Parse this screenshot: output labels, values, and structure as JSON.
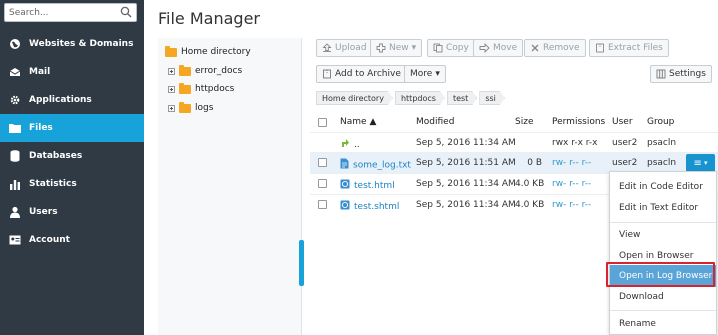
{
  "sidebar": {
    "search": {
      "placeholder": "Search...",
      "value": ""
    },
    "items": [
      {
        "label": "Websites & Domains",
        "icon": "globe-icon",
        "active": false
      },
      {
        "label": "Mail",
        "icon": "envelope-icon",
        "active": false
      },
      {
        "label": "Applications",
        "icon": "gear-icon",
        "active": false
      },
      {
        "label": "Files",
        "icon": "folder-icon",
        "active": true
      },
      {
        "label": "Databases",
        "icon": "database-icon",
        "active": false
      },
      {
        "label": "Statistics",
        "icon": "bar-chart-icon",
        "active": false
      },
      {
        "label": "Users",
        "icon": "user-icon",
        "active": false
      },
      {
        "label": "Account",
        "icon": "id-card-icon",
        "active": false
      }
    ]
  },
  "page": {
    "title": "File Manager"
  },
  "tree": {
    "root": "Home directory",
    "children": [
      "error_docs",
      "httpdocs",
      "logs"
    ]
  },
  "toolbar": {
    "upload": "Upload",
    "new": "New",
    "copy": "Copy",
    "move": "Move",
    "remove": "Remove",
    "extract": "Extract Files",
    "archive": "Add to Archive",
    "more": "More",
    "settings": "Settings"
  },
  "breadcrumb": [
    "Home directory",
    "httpdocs",
    "test",
    "ssi"
  ],
  "table": {
    "headers": {
      "name": "Name",
      "modified": "Modified",
      "size": "Size",
      "permissions": "Permissions",
      "user": "User",
      "group": "Group"
    },
    "rows": [
      {
        "name": "..",
        "modified": "Sep 5, 2016 11:34 AM",
        "size": "",
        "permissions": "rwx r-x r-x",
        "user": "user2",
        "group": "psacln"
      },
      {
        "name": "some_log.txt",
        "modified": "Sep 5, 2016 11:51 AM",
        "size": "0 B",
        "permissions": "rw- r-- r--",
        "user": "user2",
        "group": "psacln"
      },
      {
        "name": "test.html",
        "modified": "Sep 5, 2016 11:34 AM",
        "size": "4.0 KB",
        "permissions": "rw- r-- r--",
        "user": "",
        "group": ""
      },
      {
        "name": "test.shtml",
        "modified": "Sep 5, 2016 11:34 AM",
        "size": "4.0 KB",
        "permissions": "rw- r-- r--",
        "user": "",
        "group": ""
      }
    ]
  },
  "context_menu": {
    "items": [
      "Edit in Code Editor",
      "Edit in Text Editor",
      "View",
      "Open in Browser",
      "Open in Log Browser",
      "Download",
      "Rename"
    ],
    "highlighted": "Open in Log Browser"
  },
  "colors": {
    "sidebar_bg": "#2f3a44",
    "accent": "#17a3d9",
    "link": "#1b82c4",
    "highlight_box": "#d9232e"
  }
}
